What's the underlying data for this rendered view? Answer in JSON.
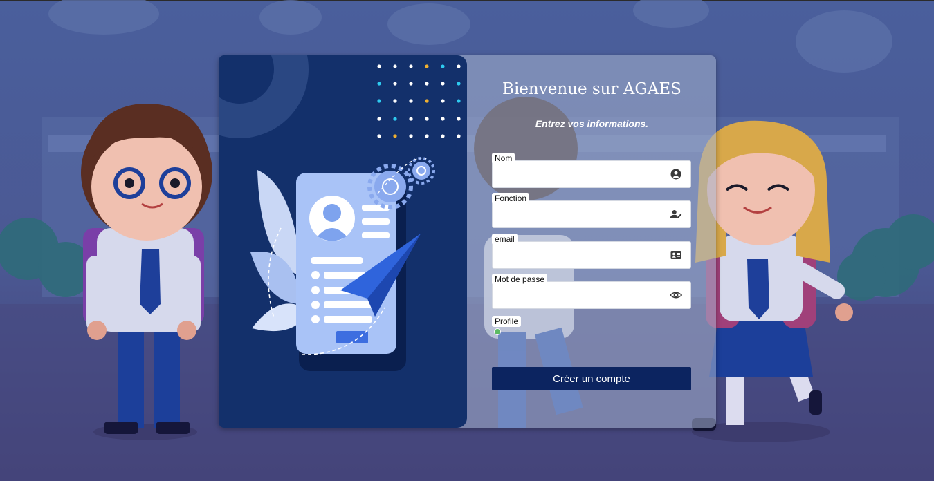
{
  "page": {
    "title": "Bienvenue sur AGAES",
    "subtitle": "Entrez vos informations."
  },
  "form": {
    "fields": [
      {
        "label": "Nom",
        "value": "",
        "icon": "account-circle-icon"
      },
      {
        "label": "Fonction",
        "value": "",
        "icon": "person-edit-icon"
      },
      {
        "label": "email",
        "value": "",
        "icon": "contact-mail-icon"
      },
      {
        "label": "Mot de passe",
        "value": "",
        "icon": "eye-icon"
      }
    ],
    "profile_label": "Profile",
    "submit_label": "Créer un compte"
  },
  "colors": {
    "accent": "#0c2460",
    "panel": "#13306b",
    "background": "#4a5f9c"
  }
}
